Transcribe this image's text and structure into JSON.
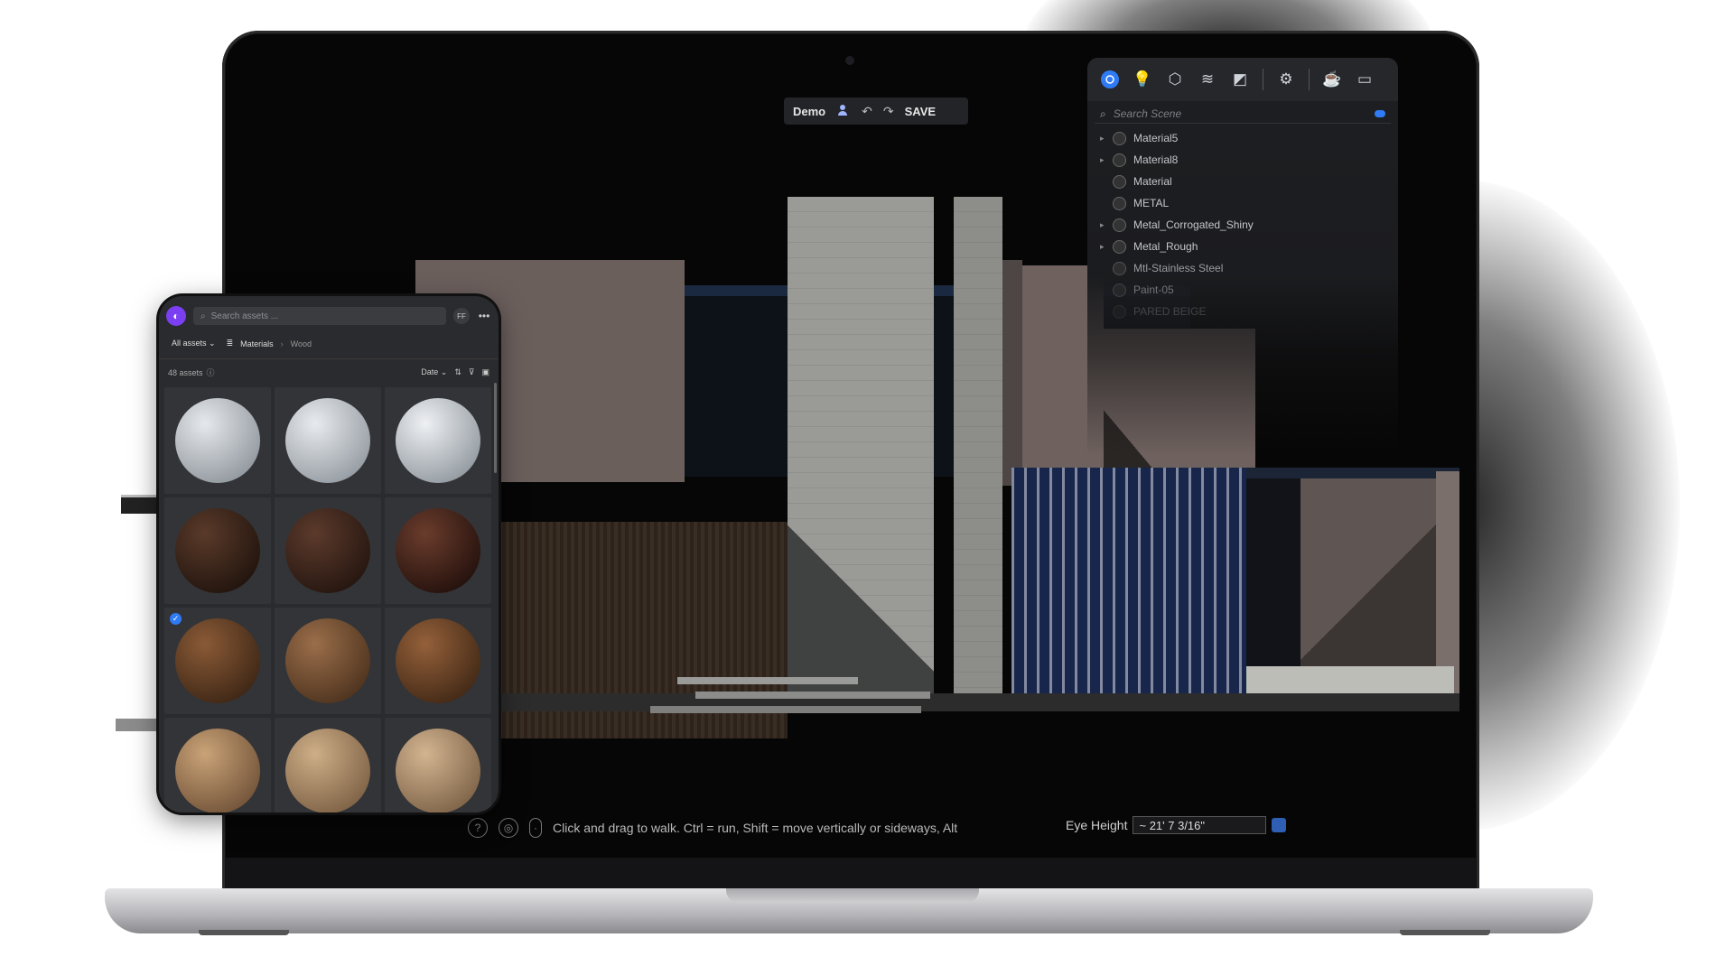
{
  "toolbar": {
    "project": "Demo",
    "save": "SAVE",
    "icons": [
      "user-icon",
      "undo-icon",
      "redo-icon"
    ]
  },
  "outliner": {
    "tool_icons": [
      "materials-icon",
      "lights-icon",
      "objects-icon",
      "layers-icon",
      "scenes-icon",
      "settings-icon",
      "teapot-icon",
      "window-icon"
    ],
    "search_placeholder": "Search Scene",
    "items": [
      {
        "label": "Material5",
        "expandable": true
      },
      {
        "label": "Material8",
        "expandable": true
      },
      {
        "label": "Material",
        "expandable": false
      },
      {
        "label": "METAL",
        "expandable": false
      },
      {
        "label": "Metal_Corrogated_Shiny",
        "expandable": true
      },
      {
        "label": "Metal_Rough",
        "expandable": true
      },
      {
        "label": "Mtl-Stainless Steel",
        "expandable": false
      },
      {
        "label": "Paint-05",
        "expandable": false
      },
      {
        "label": "PARED BEIGE",
        "expandable": false
      }
    ]
  },
  "status": {
    "hint": "Click and drag to walk. Ctrl = run, Shift = move vertically or sideways, Alt",
    "eye_label": "Eye Height",
    "eye_value": "~ 21' 7 3/16\""
  },
  "assets": {
    "search_placeholder": "Search assets ...",
    "user_initials": "FF",
    "filter": "All assets",
    "breadcrumb_root": "Materials",
    "breadcrumb_leaf": "Wood",
    "count": "48 assets",
    "sort": "Date",
    "swatches": [
      {
        "c1": "#e6e9ec",
        "c2": "#8c939a",
        "selected": false
      },
      {
        "c1": "#e8ebee",
        "c2": "#90979e",
        "selected": false
      },
      {
        "c1": "#eef0f3",
        "c2": "#8d959c",
        "selected": false
      },
      {
        "c1": "#5a3a2a",
        "c2": "#1e120c",
        "selected": false
      },
      {
        "c1": "#5c3a2c",
        "c2": "#22140e",
        "selected": false
      },
      {
        "c1": "#6a3c2c",
        "c2": "#200f0b",
        "selected": false
      },
      {
        "c1": "#8a5a36",
        "c2": "#3a2414",
        "selected": true
      },
      {
        "c1": "#9a6e4a",
        "c2": "#4a301c",
        "selected": false
      },
      {
        "c1": "#94603a",
        "c2": "#3e2614",
        "selected": false
      },
      {
        "c1": "#c9a277",
        "c2": "#6e5036",
        "selected": false
      },
      {
        "c1": "#cdae87",
        "c2": "#7a5e42",
        "selected": false
      },
      {
        "c1": "#d2b490",
        "c2": "#7a5f44",
        "selected": false
      }
    ]
  }
}
